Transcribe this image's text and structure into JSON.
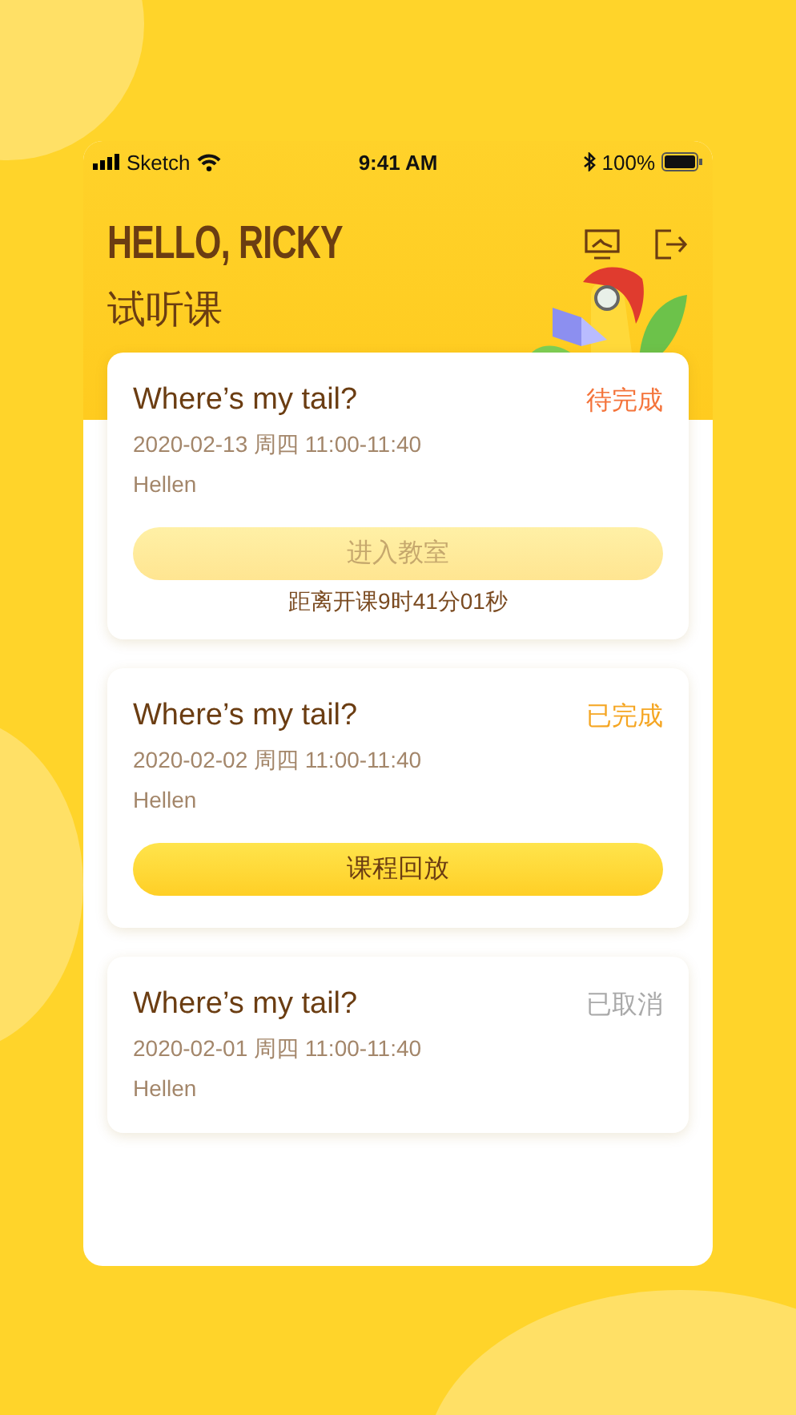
{
  "status_bar": {
    "carrier": "Sketch",
    "time": "9:41 AM",
    "battery": "100%"
  },
  "header": {
    "greeting": "HELLO, RICKY",
    "title": "试听课"
  },
  "lessons": [
    {
      "title": "Where’s my tail?",
      "status": {
        "label": "待完成",
        "kind": "pending"
      },
      "schedule": "2020-02-13 周四 11:00-11:40",
      "teacher": "Hellen",
      "button": {
        "label": "进入教室",
        "disabled": true
      },
      "countdown": "距离开课9时41分01秒"
    },
    {
      "title": "Where’s my tail?",
      "status": {
        "label": "已完成",
        "kind": "done"
      },
      "schedule": "2020-02-02 周四 11:00-11:40",
      "teacher": "Hellen",
      "button": {
        "label": "课程回放",
        "disabled": false
      }
    },
    {
      "title": "Where’s my tail?",
      "status": {
        "label": "已取消",
        "kind": "cancelled"
      },
      "schedule": "2020-02-01 周四 11:00-11:40",
      "teacher": "Hellen"
    }
  ]
}
